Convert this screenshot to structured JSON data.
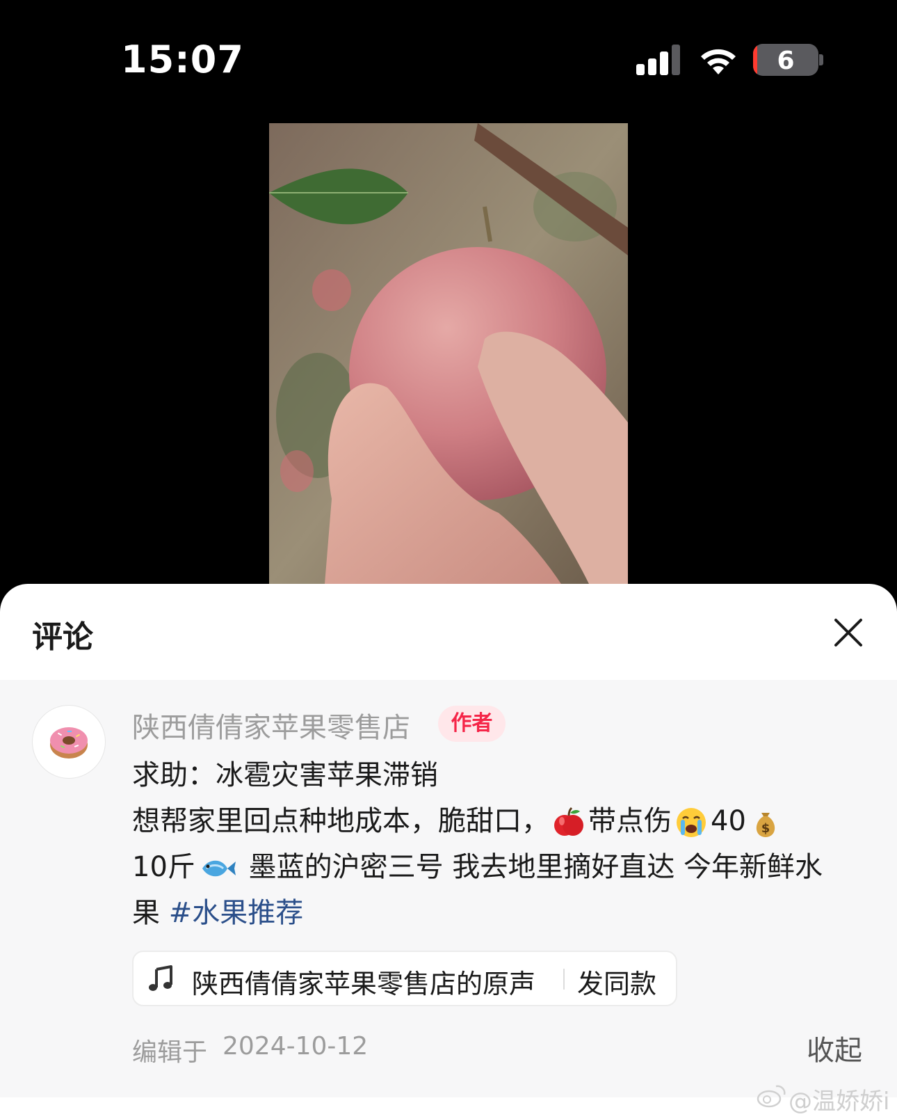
{
  "status_bar": {
    "time": "15:07",
    "battery": "6",
    "battery_fraction": 0.06
  },
  "sheet": {
    "title": "评论",
    "author": {
      "name": "陕西倩倩家苹果零售店",
      "tag": "作者"
    },
    "post": {
      "line1": "求助：冰雹灾害苹果滞销",
      "line2_a": "想帮家里回点种地成本，脆甜口，",
      "line2_b": "带点伤",
      "line2_c": "40",
      "line3_a": "10斤",
      "line3_b": " 墨蓝的沪密三号 我去地里摘好直达 今年新鲜水",
      "line4_a": "果 ",
      "hashtag": "#水果推荐"
    },
    "music": {
      "name": "陕西倩倩家苹果零售店的原声",
      "action": "发同款"
    },
    "edited_label": "编辑于",
    "edited_date": "2024-10-12",
    "collapse": "收起"
  },
  "watermark": "@温娇娇i",
  "icons": [
    "signal-icon",
    "wifi-icon",
    "battery-icon",
    "close-icon",
    "donut-avatar-icon",
    "apple-emoji",
    "crying-emoji",
    "money-bag-emoji",
    "fish-emoji",
    "music-note-icon",
    "weibo-logo-icon"
  ]
}
